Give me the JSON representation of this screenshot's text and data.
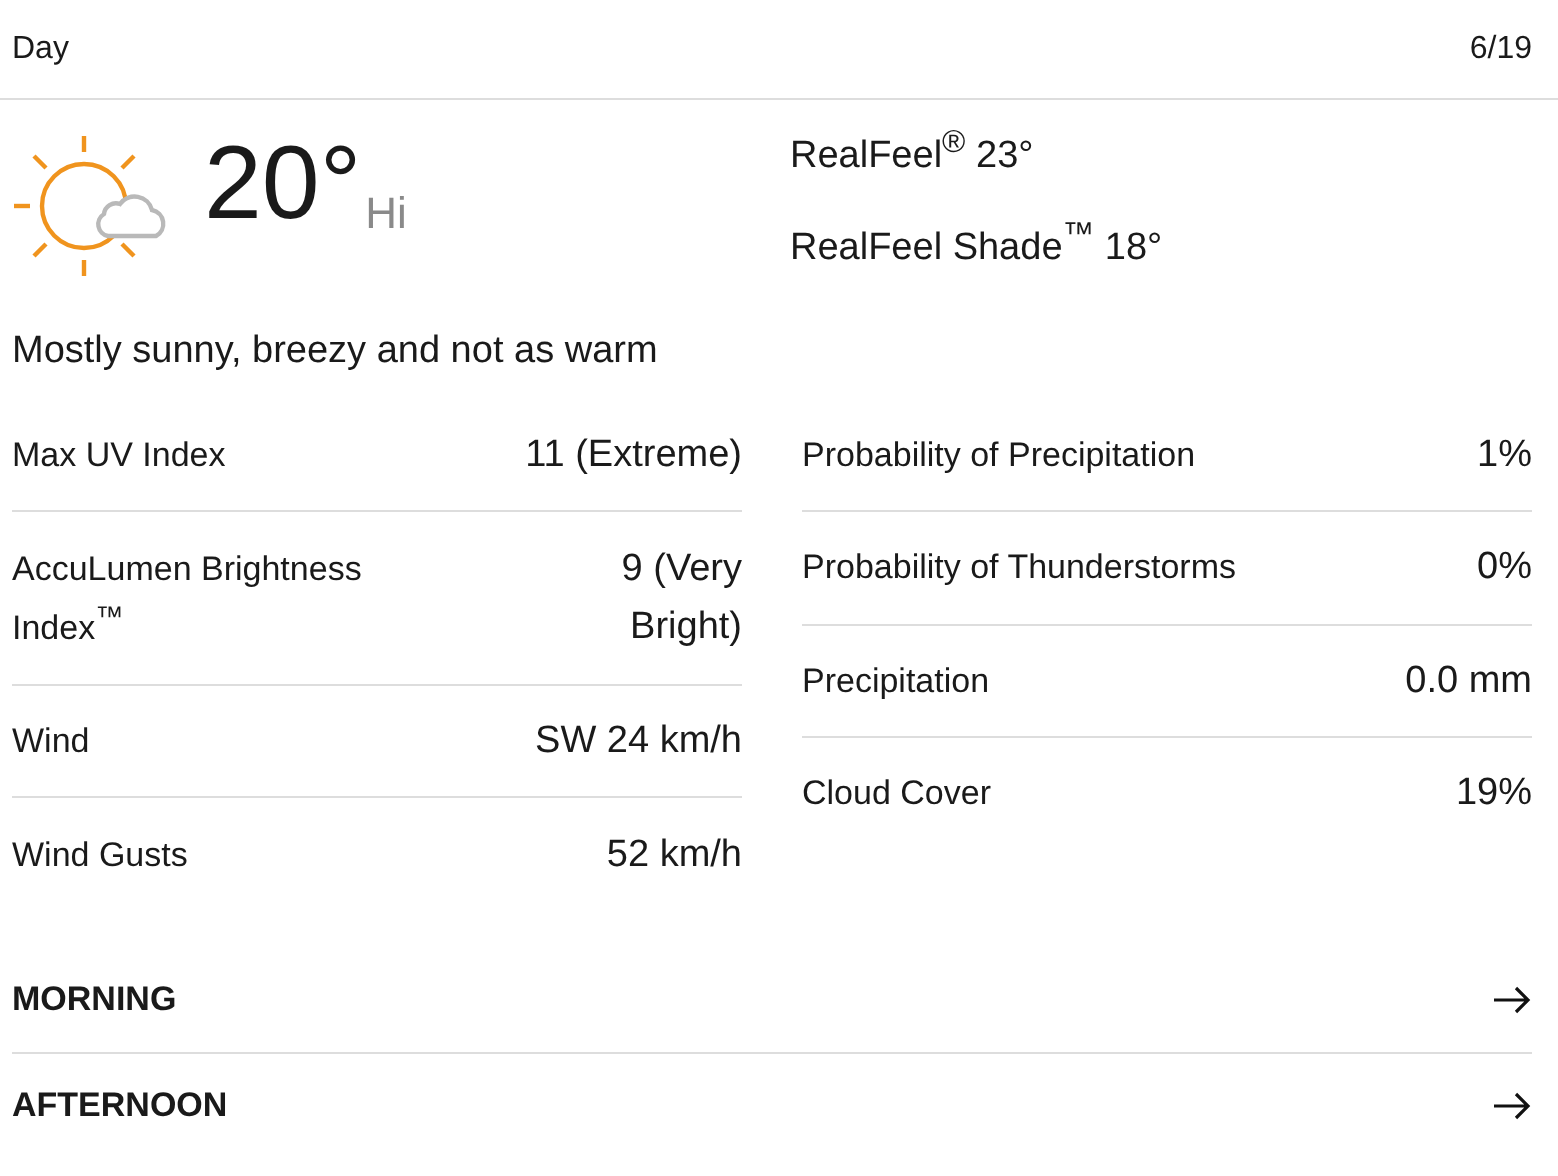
{
  "header": {
    "title": "Day",
    "date": "6/19"
  },
  "current": {
    "temperature": "20°",
    "label": "Hi",
    "realfeel": "RealFeel$^{®}$ 23°",
    "realfeel_shade": "RealFeel Shade$^{™}$ 18°"
  },
  "phrase": "Mostly sunny, breezy and not as warm",
  "left_details": [
    {
      "label": "Max UV Index",
      "value": "11 (Extreme)"
    },
    {
      "label": "AccuLumen Brightness Index$^{™}$",
      "value": "9 (Very Bright)"
    },
    {
      "label": "Wind",
      "value": "SW 24 km/h"
    },
    {
      "label": "Wind Gusts",
      "value": "52 km/h"
    }
  ],
  "right_details": [
    {
      "label": "Probability of Precipitation",
      "value": "1%"
    },
    {
      "label": "Probability of Thunderstorms",
      "value": "0%"
    },
    {
      "label": "Precipitation",
      "value": "0.0 mm"
    },
    {
      "label": "Cloud Cover",
      "value": "19%"
    }
  ],
  "links": [
    {
      "label": "MORNING"
    },
    {
      "label": "AFTERNOON"
    }
  ]
}
